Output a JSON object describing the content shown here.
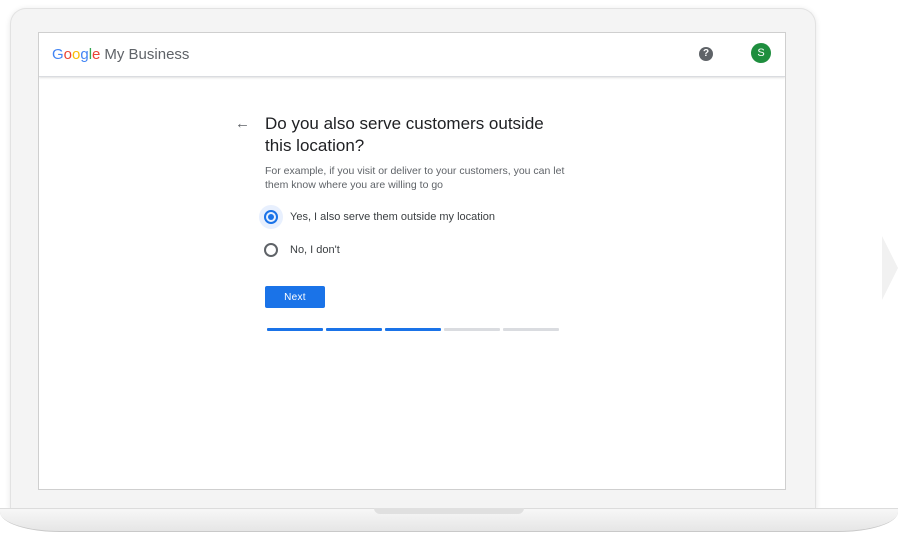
{
  "app": {
    "logo_letters": [
      "G",
      "o",
      "o",
      "g",
      "l",
      "e"
    ],
    "product_name": "My Business",
    "help_icon": "question-mark-circle-icon",
    "help_glyph": "?",
    "avatar_initial": "S",
    "avatar_color": "#1e8e3e"
  },
  "main": {
    "back_icon": "arrow-left-icon",
    "back_glyph": "←",
    "question": "Do you also serve customers outside this location?",
    "helper_text": "For example, if you visit or deliver to your customers, you can let them know where you are willing to go",
    "options": [
      {
        "label": "Yes, I also serve them outside my location",
        "selected": true
      },
      {
        "label": "No, I don't",
        "selected": false
      }
    ],
    "next_label": "Next",
    "progress": {
      "completed_steps": 3,
      "total_steps": 5
    }
  },
  "colors": {
    "accent": "#1a73e8",
    "text_primary": "#202124",
    "text_secondary": "#5f6368"
  }
}
